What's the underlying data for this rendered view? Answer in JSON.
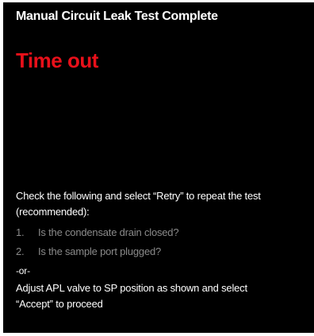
{
  "screen": {
    "title": "Manual Circuit Leak Test Complete",
    "status": "Time out",
    "status_color": "#e8101a",
    "instruction_line1": "Check the following and select “Retry” to repeat the test",
    "instruction_line2": "(recommended):",
    "checklist": [
      {
        "num": "1.",
        "text": "Is the condensate drain closed?"
      },
      {
        "num": "2.",
        "text": "Is the sample port plugged?"
      }
    ],
    "or_label": "-or-",
    "alt_line1": "Adjust APL valve to SP position as shown and select",
    "alt_line2": "“Accept” to proceed"
  }
}
